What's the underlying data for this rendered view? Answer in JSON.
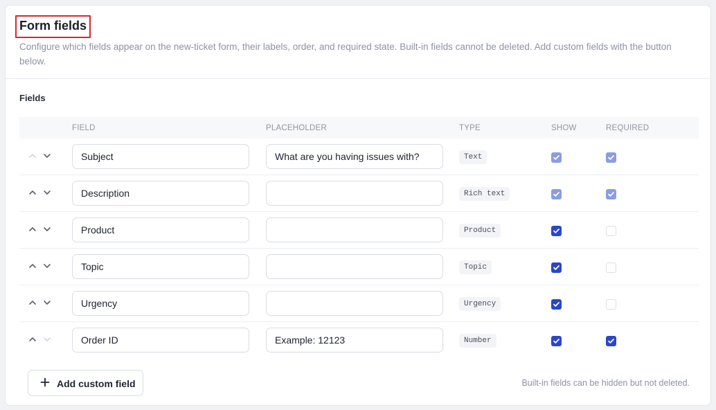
{
  "header": {
    "title": "Form fields",
    "description": "Configure which fields appear on the new-ticket form, their labels, order, and required state. Built-in fields cannot be deleted. Add custom fields with the button below."
  },
  "section": {
    "label": "Fields"
  },
  "columns": {
    "field": "FIELD",
    "placeholder": "PLACEHOLDER",
    "type": "TYPE",
    "show": "SHOW",
    "required": "REQUIRED"
  },
  "rows": [
    {
      "field": "Subject",
      "placeholder": "What are you having issues with?",
      "type": "Text",
      "show": "checked-disabled",
      "required": "checked-disabled",
      "up_enabled": false,
      "down_enabled": true
    },
    {
      "field": "Description",
      "placeholder": "",
      "type": "Rich text",
      "show": "checked-disabled",
      "required": "checked-disabled",
      "up_enabled": true,
      "down_enabled": true
    },
    {
      "field": "Product",
      "placeholder": "",
      "type": "Product",
      "show": "checked",
      "required": "unchecked-disabled",
      "up_enabled": true,
      "down_enabled": true
    },
    {
      "field": "Topic",
      "placeholder": "",
      "type": "Topic",
      "show": "checked",
      "required": "unchecked-disabled",
      "up_enabled": true,
      "down_enabled": true
    },
    {
      "field": "Urgency",
      "placeholder": "",
      "type": "Urgency",
      "show": "checked",
      "required": "unchecked-disabled",
      "up_enabled": true,
      "down_enabled": true
    },
    {
      "field": "Order ID",
      "placeholder": "Example: 12123",
      "type": "Number",
      "show": "checked",
      "required": "checked",
      "up_enabled": true,
      "down_enabled": false
    }
  ],
  "footer": {
    "add_button_label": "Add custom field",
    "add_button_icon": "plus-icon",
    "note": "Built-in fields can be hidden but not deleted."
  },
  "colors": {
    "accent": "#2b46c8",
    "accent_disabled": "#8a9ddf",
    "highlight_border": "#d6262f"
  }
}
